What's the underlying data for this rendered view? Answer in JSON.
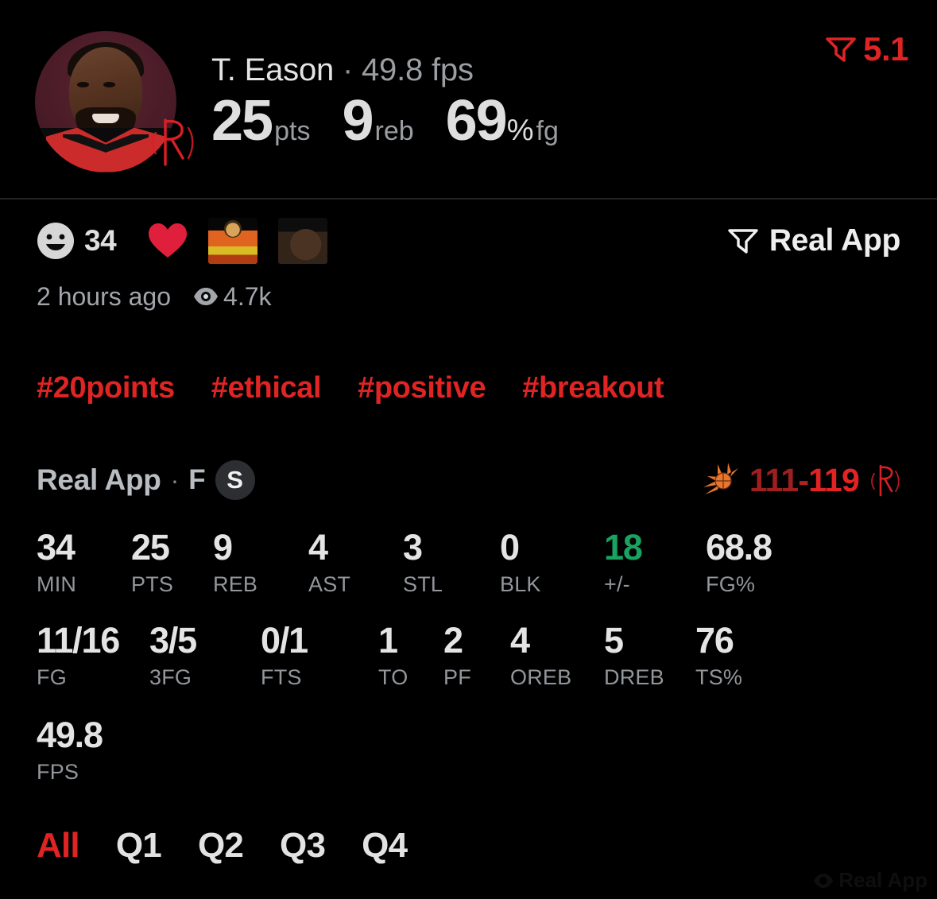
{
  "header": {
    "avatar_name": "player-headshot",
    "team_logo": "rockets-logo",
    "player_name": "T. Eason",
    "separator": "·",
    "fps_label": "49.8 fps",
    "big_stats": [
      {
        "value": "25",
        "unit": "pts"
      },
      {
        "value": "9",
        "unit": "reb"
      },
      {
        "value": "69",
        "pct": "%",
        "unit": "fg"
      }
    ],
    "rating": {
      "icon": "real-app-logo",
      "value": "5.1"
    }
  },
  "post": {
    "reactions": {
      "emoji_icon": "smiley-icon",
      "count": "34",
      "heart_icon": "heart-icon",
      "stickers": [
        "drake-sticker",
        "lebron-sticker"
      ]
    },
    "brand": {
      "icon": "real-app-logo",
      "label": "Real App"
    },
    "timestamp": "2 hours ago",
    "views_icon": "eye-icon",
    "views": "4.7k",
    "hashtags": [
      "#20points",
      "#ethical",
      "#positive",
      "#breakout"
    ]
  },
  "game": {
    "source": "Real App",
    "dot": "·",
    "position": "F",
    "badge": "S",
    "away_logo": "suns-logo",
    "home_logo": "rockets-logo",
    "away_score": "111",
    "dash": "-",
    "home_score": "119"
  },
  "stats": {
    "row1": [
      {
        "value": "34",
        "label": "MIN",
        "positive": false
      },
      {
        "value": "25",
        "label": "PTS",
        "positive": false
      },
      {
        "value": "9",
        "label": "REB",
        "positive": false
      },
      {
        "value": "4",
        "label": "AST",
        "positive": false
      },
      {
        "value": "3",
        "label": "STL",
        "positive": false
      },
      {
        "value": "0",
        "label": "BLK",
        "positive": false
      },
      {
        "value": "18",
        "label": "+/-",
        "positive": true
      },
      {
        "value": "68.8",
        "label": "FG%",
        "positive": false
      }
    ],
    "row2": [
      {
        "value": "11/16",
        "label": "FG"
      },
      {
        "value": "3/5",
        "label": "3FG"
      },
      {
        "value": "0/1",
        "label": "FTS"
      },
      {
        "value": "1",
        "label": "TO"
      },
      {
        "value": "2",
        "label": "PF"
      },
      {
        "value": "4",
        "label": "OREB"
      },
      {
        "value": "5",
        "label": "DREB"
      },
      {
        "value": "76",
        "label": "TS%"
      }
    ],
    "row3": [
      {
        "value": "49.8",
        "label": "FPS"
      }
    ]
  },
  "quarter_tabs": [
    {
      "label": "All",
      "active": true
    },
    {
      "label": "Q1",
      "active": false
    },
    {
      "label": "Q2",
      "active": false
    },
    {
      "label": "Q3",
      "active": false
    },
    {
      "label": "Q4",
      "active": false
    }
  ],
  "watermark": {
    "icon": "eye-watermark-icon",
    "text": "Real App"
  },
  "colors": {
    "background": "#000000",
    "accent_red": "#e02424",
    "positive_green": "#18a361",
    "text_primary": "#e4e4e4",
    "text_secondary": "#93969a",
    "score_home": "#e02424",
    "score_away": "#9e1f1f"
  }
}
